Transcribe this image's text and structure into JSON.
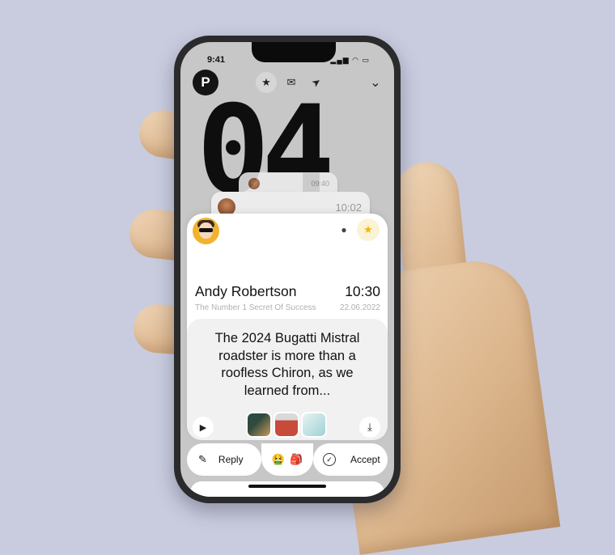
{
  "status_bar": {
    "time": "9:41",
    "icons": "▂▄▆ ◠ ▭"
  },
  "app": {
    "logo_letter": "P"
  },
  "header": {
    "star_icon": "★",
    "inbox_icon": "✉",
    "send_icon": "➤",
    "chevron_icon": "⌄"
  },
  "date_display": {
    "value": "04"
  },
  "stacked_messages": [
    {
      "time": "09:40"
    },
    {
      "time": "10:02"
    }
  ],
  "message": {
    "sender": "Andy Robertson",
    "subject": "The Number 1 Secret Of Success",
    "time": "10:30",
    "date": "22.06.2022",
    "preview": "The 2024 Bugatti Mistral roadster is more than a roofless Chiron, as we learned from...",
    "comment_icon": "●",
    "star_icon": "★",
    "play_icon": "▶",
    "download_icon": "⤓",
    "attachments": [
      {
        "name": "attachment-1",
        "color": "#2f4b3e"
      },
      {
        "name": "attachment-2",
        "color": "#c84a3a"
      },
      {
        "name": "attachment-3",
        "color": "#9fd2d4"
      }
    ]
  },
  "actions": {
    "reply_label": "Reply",
    "reply_icon": "✎",
    "reactions": [
      "🤮",
      "🎒"
    ],
    "accept_label": "Accept",
    "accept_icon": "✓"
  },
  "colors": {
    "accent_star": "#f4b400",
    "background": "#c9ccdf"
  }
}
